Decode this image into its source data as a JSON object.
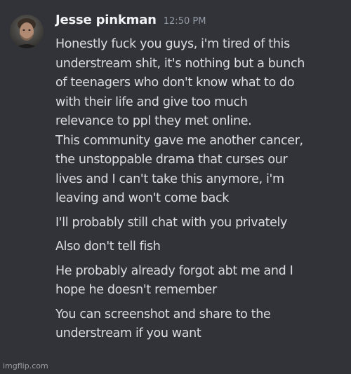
{
  "message": {
    "author": "Jesse pinkman",
    "timestamp": "12:50 PM",
    "paragraphs": [
      [
        "Honestly fuck you guys, i'm tired of this",
        "understream shit, it's nothing but a bunch",
        "of teenagers who don't know what to do",
        "with their life and give too much",
        "relevance to ppl they met online.",
        "This community gave me another cancer,",
        "the unstoppable drama that curses our",
        "lives and I can't take this anymore, i'm",
        "leaving and won't come back"
      ],
      [
        "I'll probably still chat with you privately"
      ],
      [
        "Also don't tell fish"
      ],
      [
        "He probably already forgot abt me and I",
        "hope he doesn't remember"
      ],
      [
        "You can screenshot and share to the",
        "understream if you want"
      ]
    ]
  },
  "watermark": "imgflip.com",
  "colors": {
    "background": "#313338",
    "username": "#f2f3f5",
    "text": "#dbdee1",
    "timestamp": "#949ba4"
  },
  "icons": {
    "avatar": "user-avatar-photo"
  }
}
